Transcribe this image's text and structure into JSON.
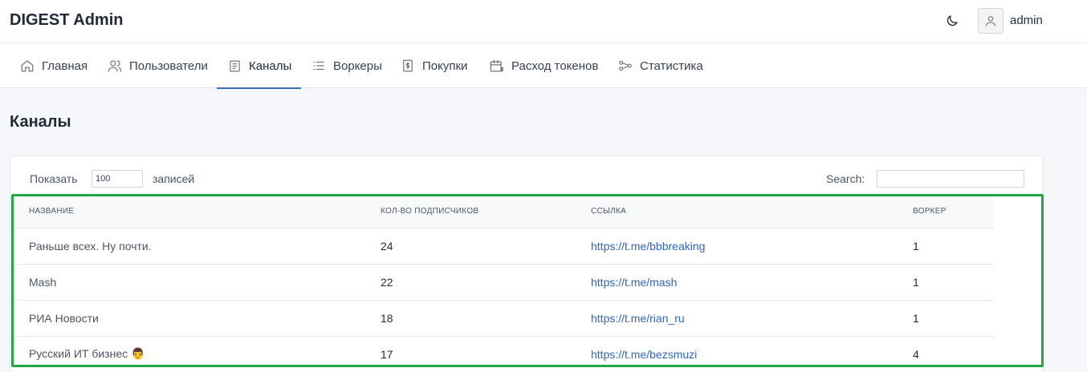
{
  "app": {
    "title": "DIGEST Admin"
  },
  "header": {
    "theme_icon": "moon-icon",
    "user": {
      "name": "admin",
      "icon": "user-icon"
    }
  },
  "nav": {
    "items": [
      {
        "label": "Главная",
        "icon": "home-icon"
      },
      {
        "label": "Пользователи",
        "icon": "users-icon"
      },
      {
        "label": "Каналы",
        "icon": "document-icon",
        "active": true
      },
      {
        "label": "Воркеры",
        "icon": "list-icon"
      },
      {
        "label": "Покупки",
        "icon": "dollar-receipt-icon"
      },
      {
        "label": "Расход токенов",
        "icon": "calendar-dollar-icon"
      },
      {
        "label": "Статистика",
        "icon": "share-nodes-icon"
      }
    ]
  },
  "page": {
    "title": "Каналы"
  },
  "table_controls": {
    "show_label": "Показать",
    "page_length": "100",
    "records_label": "записей",
    "search_label": "Search:",
    "search_value": ""
  },
  "table": {
    "columns": [
      "Название",
      "Кол-во подписчиков",
      "Ссылка",
      "Воркер"
    ],
    "rows": [
      {
        "name": "Раньше всех. Ну почти.",
        "subscribers": "24",
        "link": "https://t.me/bbbreaking",
        "worker": "1"
      },
      {
        "name": "Mash",
        "subscribers": "22",
        "link": "https://t.me/mash",
        "worker": "1"
      },
      {
        "name": "РИА Новости",
        "subscribers": "18",
        "link": "https://t.me/rian_ru",
        "worker": "1"
      },
      {
        "name": "Русский ИТ бизнес 👨",
        "subscribers": "17",
        "link": "https://t.me/bezsmuzi",
        "worker": "4"
      }
    ]
  },
  "colors": {
    "accent": "#3b6fb5",
    "link": "#2f66b3",
    "highlight": "#22a447"
  }
}
